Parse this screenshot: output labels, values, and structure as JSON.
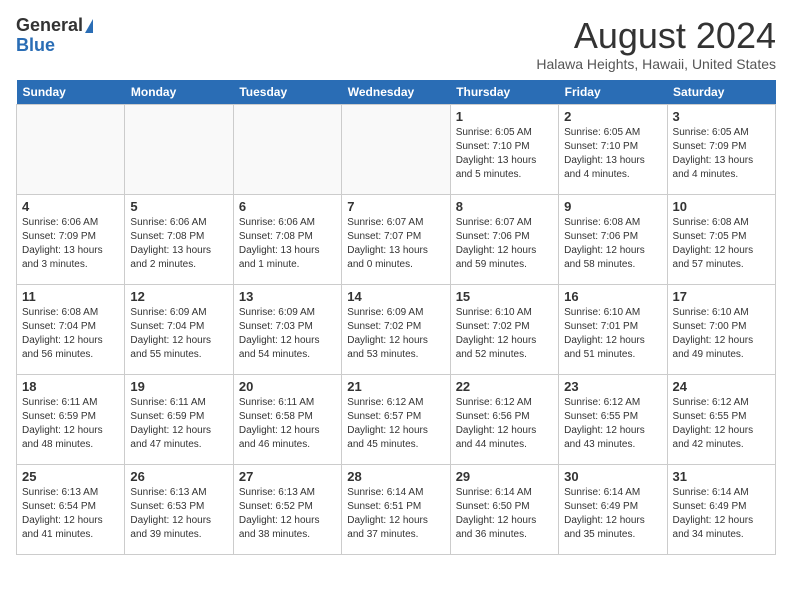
{
  "header": {
    "logo_general": "General",
    "logo_blue": "Blue",
    "title": "August 2024",
    "subtitle": "Halawa Heights, Hawaii, United States"
  },
  "days_of_week": [
    "Sunday",
    "Monday",
    "Tuesday",
    "Wednesday",
    "Thursday",
    "Friday",
    "Saturday"
  ],
  "weeks": [
    [
      {
        "day": "",
        "info": ""
      },
      {
        "day": "",
        "info": ""
      },
      {
        "day": "",
        "info": ""
      },
      {
        "day": "",
        "info": ""
      },
      {
        "day": "1",
        "info": "Sunrise: 6:05 AM\nSunset: 7:10 PM\nDaylight: 13 hours\nand 5 minutes."
      },
      {
        "day": "2",
        "info": "Sunrise: 6:05 AM\nSunset: 7:10 PM\nDaylight: 13 hours\nand 4 minutes."
      },
      {
        "day": "3",
        "info": "Sunrise: 6:05 AM\nSunset: 7:09 PM\nDaylight: 13 hours\nand 4 minutes."
      }
    ],
    [
      {
        "day": "4",
        "info": "Sunrise: 6:06 AM\nSunset: 7:09 PM\nDaylight: 13 hours\nand 3 minutes."
      },
      {
        "day": "5",
        "info": "Sunrise: 6:06 AM\nSunset: 7:08 PM\nDaylight: 13 hours\nand 2 minutes."
      },
      {
        "day": "6",
        "info": "Sunrise: 6:06 AM\nSunset: 7:08 PM\nDaylight: 13 hours\nand 1 minute."
      },
      {
        "day": "7",
        "info": "Sunrise: 6:07 AM\nSunset: 7:07 PM\nDaylight: 13 hours\nand 0 minutes."
      },
      {
        "day": "8",
        "info": "Sunrise: 6:07 AM\nSunset: 7:06 PM\nDaylight: 12 hours\nand 59 minutes."
      },
      {
        "day": "9",
        "info": "Sunrise: 6:08 AM\nSunset: 7:06 PM\nDaylight: 12 hours\nand 58 minutes."
      },
      {
        "day": "10",
        "info": "Sunrise: 6:08 AM\nSunset: 7:05 PM\nDaylight: 12 hours\nand 57 minutes."
      }
    ],
    [
      {
        "day": "11",
        "info": "Sunrise: 6:08 AM\nSunset: 7:04 PM\nDaylight: 12 hours\nand 56 minutes."
      },
      {
        "day": "12",
        "info": "Sunrise: 6:09 AM\nSunset: 7:04 PM\nDaylight: 12 hours\nand 55 minutes."
      },
      {
        "day": "13",
        "info": "Sunrise: 6:09 AM\nSunset: 7:03 PM\nDaylight: 12 hours\nand 54 minutes."
      },
      {
        "day": "14",
        "info": "Sunrise: 6:09 AM\nSunset: 7:02 PM\nDaylight: 12 hours\nand 53 minutes."
      },
      {
        "day": "15",
        "info": "Sunrise: 6:10 AM\nSunset: 7:02 PM\nDaylight: 12 hours\nand 52 minutes."
      },
      {
        "day": "16",
        "info": "Sunrise: 6:10 AM\nSunset: 7:01 PM\nDaylight: 12 hours\nand 51 minutes."
      },
      {
        "day": "17",
        "info": "Sunrise: 6:10 AM\nSunset: 7:00 PM\nDaylight: 12 hours\nand 49 minutes."
      }
    ],
    [
      {
        "day": "18",
        "info": "Sunrise: 6:11 AM\nSunset: 6:59 PM\nDaylight: 12 hours\nand 48 minutes."
      },
      {
        "day": "19",
        "info": "Sunrise: 6:11 AM\nSunset: 6:59 PM\nDaylight: 12 hours\nand 47 minutes."
      },
      {
        "day": "20",
        "info": "Sunrise: 6:11 AM\nSunset: 6:58 PM\nDaylight: 12 hours\nand 46 minutes."
      },
      {
        "day": "21",
        "info": "Sunrise: 6:12 AM\nSunset: 6:57 PM\nDaylight: 12 hours\nand 45 minutes."
      },
      {
        "day": "22",
        "info": "Sunrise: 6:12 AM\nSunset: 6:56 PM\nDaylight: 12 hours\nand 44 minutes."
      },
      {
        "day": "23",
        "info": "Sunrise: 6:12 AM\nSunset: 6:55 PM\nDaylight: 12 hours\nand 43 minutes."
      },
      {
        "day": "24",
        "info": "Sunrise: 6:12 AM\nSunset: 6:55 PM\nDaylight: 12 hours\nand 42 minutes."
      }
    ],
    [
      {
        "day": "25",
        "info": "Sunrise: 6:13 AM\nSunset: 6:54 PM\nDaylight: 12 hours\nand 41 minutes."
      },
      {
        "day": "26",
        "info": "Sunrise: 6:13 AM\nSunset: 6:53 PM\nDaylight: 12 hours\nand 39 minutes."
      },
      {
        "day": "27",
        "info": "Sunrise: 6:13 AM\nSunset: 6:52 PM\nDaylight: 12 hours\nand 38 minutes."
      },
      {
        "day": "28",
        "info": "Sunrise: 6:14 AM\nSunset: 6:51 PM\nDaylight: 12 hours\nand 37 minutes."
      },
      {
        "day": "29",
        "info": "Sunrise: 6:14 AM\nSunset: 6:50 PM\nDaylight: 12 hours\nand 36 minutes."
      },
      {
        "day": "30",
        "info": "Sunrise: 6:14 AM\nSunset: 6:49 PM\nDaylight: 12 hours\nand 35 minutes."
      },
      {
        "day": "31",
        "info": "Sunrise: 6:14 AM\nSunset: 6:49 PM\nDaylight: 12 hours\nand 34 minutes."
      }
    ]
  ]
}
